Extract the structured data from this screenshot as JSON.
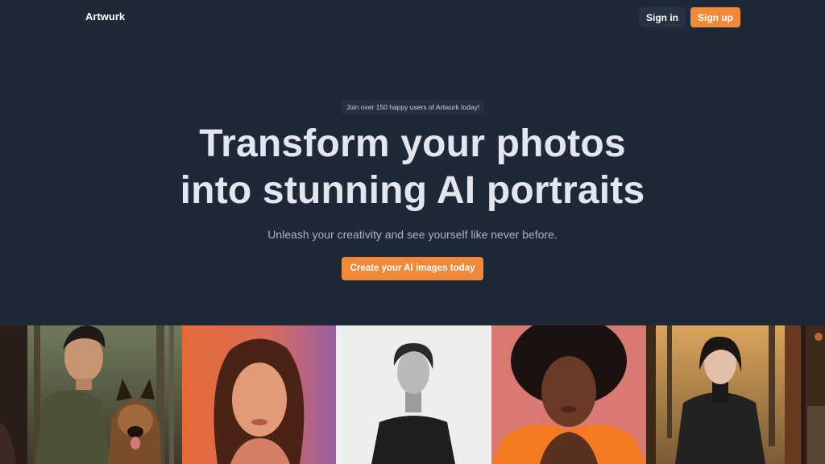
{
  "nav": {
    "brand": "Artwurk",
    "sign_in": "Sign in",
    "sign_up": "Sign up"
  },
  "hero": {
    "badge": "Join over 150 happy users of Artwurk today!",
    "title_line1": "Transform your photos",
    "title_line2": "into stunning AI portraits",
    "subtitle": "Unleash your creativity and see yourself like never before.",
    "cta": "Create your AI images today"
  },
  "colors": {
    "background": "#1f2837",
    "accent": "#f08a3a",
    "secondary_button": "#273244"
  }
}
